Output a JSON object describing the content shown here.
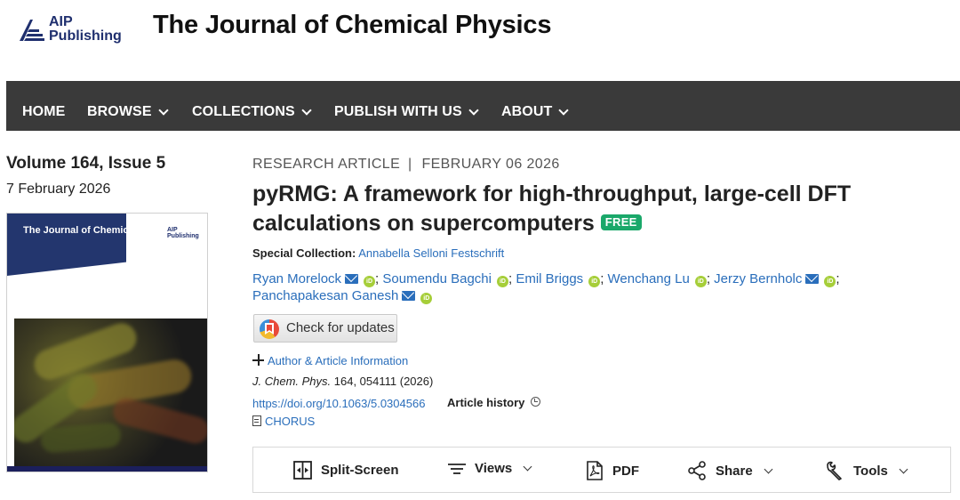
{
  "header": {
    "publisher_line1": "AIP",
    "publisher_line2": "Publishing",
    "journal_title": "The Journal of Chemical Physics"
  },
  "nav": {
    "items": [
      {
        "label": "HOME",
        "dropdown": false
      },
      {
        "label": "BROWSE",
        "dropdown": true
      },
      {
        "label": "COLLECTIONS",
        "dropdown": true
      },
      {
        "label": "PUBLISH WITH US",
        "dropdown": true
      },
      {
        "label": "ABOUT",
        "dropdown": true
      }
    ]
  },
  "issue": {
    "volume": "Volume 164, Issue 5",
    "date": "7 February 2026",
    "cover_title": "The Journal of Chemical Physics",
    "cover_publisher": "AIP Publishing"
  },
  "article": {
    "type": "RESEARCH ARTICLE",
    "separator": "|",
    "date": "FEBRUARY 06 2026",
    "title": "pyRMG: A framework for high-throughput, large-cell DFT calculations on supercomputers",
    "free_badge": "FREE",
    "special_collection_label": "Special Collection:",
    "special_collection": "Annabella Selloni Festschrift",
    "authors": [
      {
        "name": "Ryan Morelock",
        "email": true,
        "orcid": true
      },
      {
        "name": "Soumendu Bagchi",
        "email": false,
        "orcid": true
      },
      {
        "name": "Emil Briggs",
        "email": false,
        "orcid": true
      },
      {
        "name": "Wenchang Lu",
        "email": false,
        "orcid": true
      },
      {
        "name": "Jerzy Bernholc",
        "email": true,
        "orcid": true
      },
      {
        "name": "Panchapakesan Ganesh",
        "email": true,
        "orcid": true
      }
    ],
    "check_updates": "Check for updates",
    "author_info": "Author & Article Information",
    "citation_journal": "J. Chem. Phys.",
    "citation_rest": "164, 054111 (2026)",
    "doi": "https://doi.org/10.1063/5.0304566",
    "history": "Article history",
    "chorus": "CHORUS"
  },
  "toolbar": {
    "split_screen": "Split-Screen",
    "views": "Views",
    "pdf": "PDF",
    "share": "Share",
    "tools": "Tools"
  },
  "colors": {
    "nav_bg": "#3a3a3a",
    "link": "#2a6ebb",
    "free_badge": "#1aa86a",
    "orcid": "#a6ce39",
    "brand_navy": "#1f2f6e"
  },
  "icons": [
    "aip-logo-icon",
    "chevron-down-icon",
    "email-icon",
    "orcid-icon",
    "check-updates-icon",
    "plus-icon",
    "history-icon",
    "document-icon",
    "split-screen-icon",
    "views-icon",
    "pdf-icon",
    "share-icon",
    "tools-icon"
  ]
}
